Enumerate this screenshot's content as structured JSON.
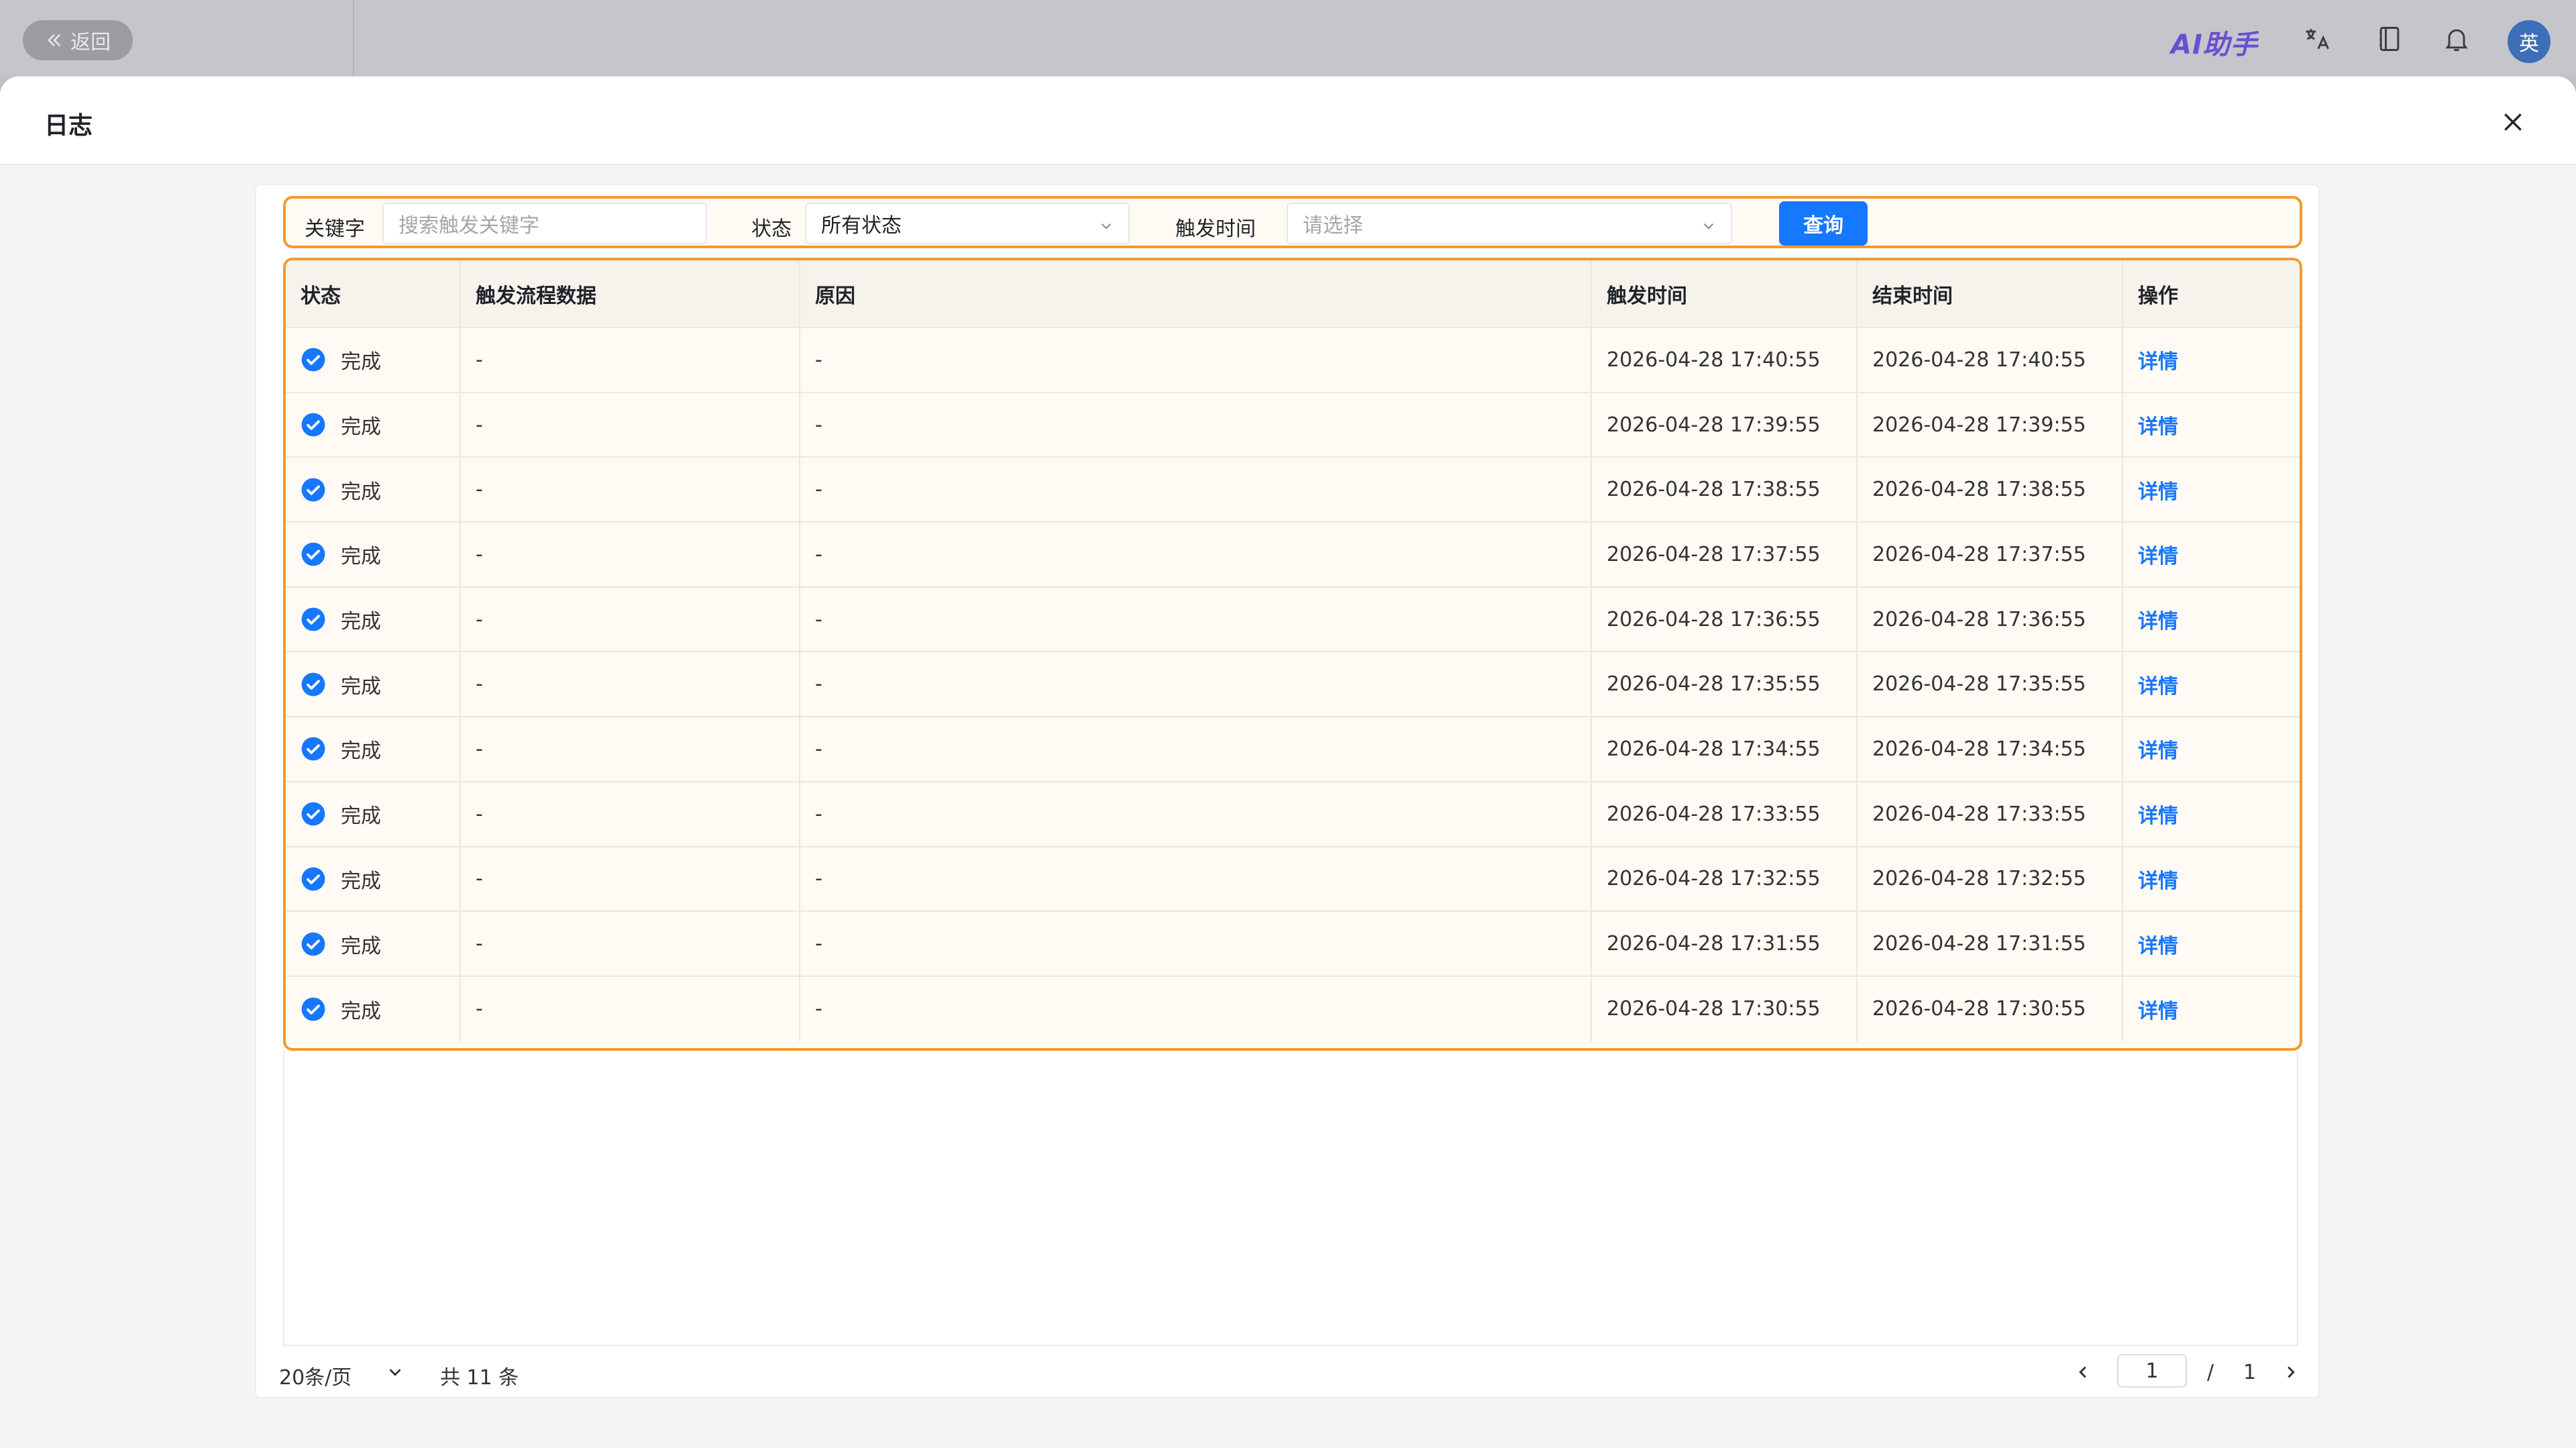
{
  "topbar": {
    "back_label": "返回",
    "ai_logo": "AI助手",
    "avatar_text": "英",
    "icons": [
      "translate-icon",
      "book-icon",
      "bell-icon"
    ]
  },
  "modal": {
    "title": "日志"
  },
  "filters": {
    "keyword_label": "关键字",
    "keyword_placeholder": "搜索触发关键字",
    "status_label": "状态",
    "status_value": "所有状态",
    "trigger_time_label": "触发时间",
    "trigger_time_placeholder": "请选择",
    "query_label": "查询"
  },
  "table": {
    "columns": [
      "状态",
      "触发流程数据",
      "原因",
      "触发时间",
      "结束时间",
      "操作"
    ],
    "rows": [
      {
        "status": "完成",
        "flow_data": "-",
        "reason": "-",
        "trigger_time": "2026-04-28 17:40:55",
        "end_time": "2026-04-28 17:40:55",
        "action": "详情"
      },
      {
        "status": "完成",
        "flow_data": "-",
        "reason": "-",
        "trigger_time": "2026-04-28 17:39:55",
        "end_time": "2026-04-28 17:39:55",
        "action": "详情"
      },
      {
        "status": "完成",
        "flow_data": "-",
        "reason": "-",
        "trigger_time": "2026-04-28 17:38:55",
        "end_time": "2026-04-28 17:38:55",
        "action": "详情"
      },
      {
        "status": "完成",
        "flow_data": "-",
        "reason": "-",
        "trigger_time": "2026-04-28 17:37:55",
        "end_time": "2026-04-28 17:37:55",
        "action": "详情"
      },
      {
        "status": "完成",
        "flow_data": "-",
        "reason": "-",
        "trigger_time": "2026-04-28 17:36:55",
        "end_time": "2026-04-28 17:36:55",
        "action": "详情"
      },
      {
        "status": "完成",
        "flow_data": "-",
        "reason": "-",
        "trigger_time": "2026-04-28 17:35:55",
        "end_time": "2026-04-28 17:35:55",
        "action": "详情"
      },
      {
        "status": "完成",
        "flow_data": "-",
        "reason": "-",
        "trigger_time": "2026-04-28 17:34:55",
        "end_time": "2026-04-28 17:34:55",
        "action": "详情"
      },
      {
        "status": "完成",
        "flow_data": "-",
        "reason": "-",
        "trigger_time": "2026-04-28 17:33:55",
        "end_time": "2026-04-28 17:33:55",
        "action": "详情"
      },
      {
        "status": "完成",
        "flow_data": "-",
        "reason": "-",
        "trigger_time": "2026-04-28 17:32:55",
        "end_time": "2026-04-28 17:32:55",
        "action": "详情"
      },
      {
        "status": "完成",
        "flow_data": "-",
        "reason": "-",
        "trigger_time": "2026-04-28 17:31:55",
        "end_time": "2026-04-28 17:31:55",
        "action": "详情"
      },
      {
        "status": "完成",
        "flow_data": "-",
        "reason": "-",
        "trigger_time": "2026-04-28 17:30:55",
        "end_time": "2026-04-28 17:30:55",
        "action": "详情"
      }
    ]
  },
  "pagination": {
    "page_size": "20条/页",
    "total": "共 11 条",
    "current_page": "1",
    "separator": "/",
    "total_pages": "1"
  },
  "colors": {
    "accent": "#1677ff",
    "highlight_border": "#f39a2c",
    "status_complete": "#1677ff"
  }
}
